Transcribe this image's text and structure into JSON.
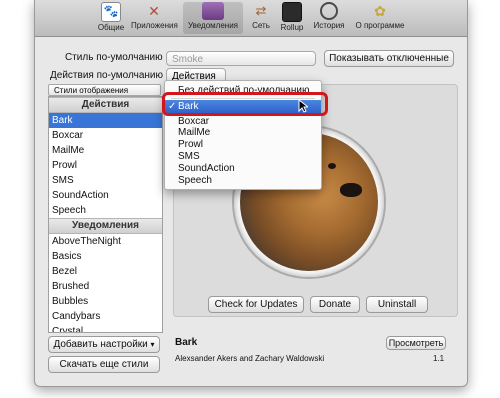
{
  "toolbar": {
    "items": [
      {
        "label": "Общие",
        "icon": "paw-icon",
        "color": "#6b6b6b"
      },
      {
        "label": "Приложения",
        "icon": "tools-icon",
        "color": "#b44b3a"
      },
      {
        "label": "Уведомления",
        "icon": "notification-icon",
        "color": "#7a4b8c"
      },
      {
        "label": "Сеть",
        "icon": "signpost-icon",
        "color": "#a0622d"
      },
      {
        "label": "Rollup",
        "icon": "rollup-icon",
        "color": "#2b2b2b"
      },
      {
        "label": "История",
        "icon": "history-icon",
        "color": "#4a4a4a"
      },
      {
        "label": "О программе",
        "icon": "about-icon",
        "color": "#c9a63a"
      }
    ]
  },
  "defaults": {
    "style_label": "Стиль по-умолчанию",
    "style_value": "Smoke",
    "action_label": "Действия по-умолчанию",
    "action_value": "Действия",
    "show_disabled_button": "Показывать отключенные"
  },
  "styles_list": {
    "filter_label": "Стили отображения",
    "section_actions": "Действия",
    "actions": [
      "Bark",
      "Boxcar",
      "MailMe",
      "Prowl",
      "SMS",
      "SoundAction",
      "Speech"
    ],
    "section_notifications": "Уведомления",
    "notifications": [
      "AboveTheNight",
      "Basics",
      "Bezel",
      "Brushed",
      "Bubbles",
      "Candybars",
      "Crystal"
    ],
    "add_settings_button": "Добавить настройки",
    "get_more_styles_button": "Скачать еще стили"
  },
  "dropdown": {
    "items": [
      "Без действий по-умолчанию",
      "Bark",
      "Boxcar",
      "MailMe",
      "Prowl",
      "SMS",
      "SoundAction",
      "Speech"
    ],
    "selected": "Bark",
    "checkmark": "✓",
    "highlight_color": "#d4151c"
  },
  "details": {
    "check_updates_button": "Check for Updates",
    "donate_button": "Donate",
    "uninstall_button": "Uninstall",
    "plugin_name": "Bark",
    "preview_button": "Просмотреть",
    "authors": "Alexsander Akers and Zachary Waldowski",
    "version": "1.1"
  },
  "colors": {
    "selection": "#3875d7",
    "window": "#e8e8e8"
  }
}
